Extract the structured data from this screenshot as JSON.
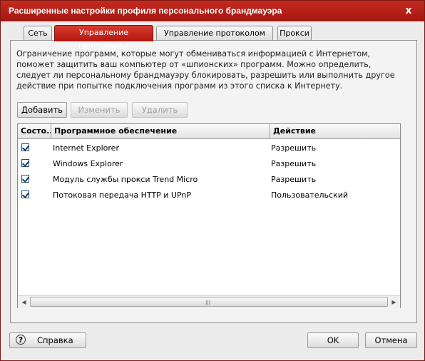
{
  "window": {
    "title": "Расширенные настройки профиля персонального брандмауэра",
    "close_glyph": "x"
  },
  "tabs": [
    {
      "label": "Сеть",
      "active": false
    },
    {
      "label": "Управление программой",
      "active": true
    },
    {
      "label": "Управление протоколом сети",
      "active": false
    },
    {
      "label": "Прокси",
      "active": false
    }
  ],
  "description": "Ограничение программ, которые могут обмениваться информацией с Интернетом, поможет защитить ваш компьютер от «шпионских» программ. Можно определить, следует ли персональному брандмауэру блокировать, разрешить или выполнить другое действие при попытке подключения программ из этого списка к Интернету.",
  "buttons": {
    "add": "Добавить",
    "edit": "Изменить",
    "delete": "Удалить"
  },
  "table": {
    "columns": [
      "Состо...",
      "Программное обеспечение",
      "Действие"
    ],
    "rows": [
      {
        "checked": true,
        "program": "Internet Explorer",
        "action": "Разрешить"
      },
      {
        "checked": true,
        "program": "Windows Explorer",
        "action": "Разрешить"
      },
      {
        "checked": true,
        "program": "Модуль службы прокси Trend Micro",
        "action": "Разрешить"
      },
      {
        "checked": true,
        "program": "Потоковая передача HTTP и UPnP",
        "action": "Пользовательский"
      }
    ]
  },
  "footer": {
    "help": "Справка",
    "ok": "OK",
    "cancel": "Отмена"
  },
  "colors": {
    "accent": "#b3170e",
    "titlebar": "#c52a1f"
  }
}
